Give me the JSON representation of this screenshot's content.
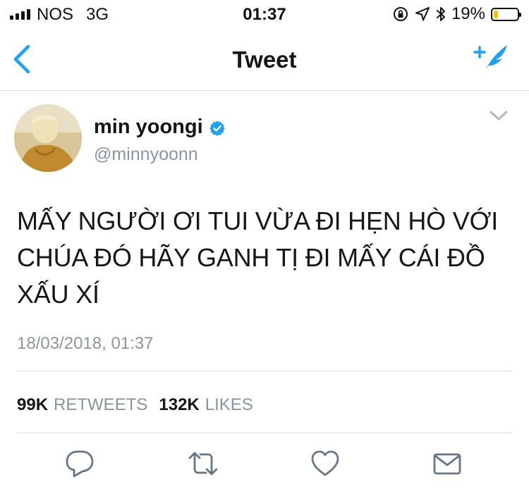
{
  "status_bar": {
    "carrier": "NOS",
    "network": "3G",
    "time": "01:37",
    "battery_percent": "19%",
    "battery_level": 0.19,
    "icons": [
      "signal-bars-icon",
      "rotation-lock-icon",
      "location-arrow-icon",
      "bluetooth-icon",
      "battery-icon"
    ]
  },
  "nav": {
    "title": "Tweet",
    "back_icon": "chevron-left-icon",
    "compose_icon": "compose-tweet-icon"
  },
  "tweet": {
    "author_name": "min yoongi",
    "handle": "@minnyoonn",
    "verified": true,
    "text": "MẤY NGƯỜI ƠI TUI VỪA ĐI HẸN HÒ VỚI CHÚA ĐÓ HÃY GANH TỊ ĐI MẤY CÁI ĐỒ XẤU XÍ",
    "timestamp": "18/03/2018, 01:37",
    "retweets_count": "99K",
    "retweets_label": "RETWEETS",
    "likes_count": "132K",
    "likes_label": "LIKES"
  },
  "actions": [
    {
      "icon": "reply-icon"
    },
    {
      "icon": "retweet-icon"
    },
    {
      "icon": "like-icon"
    },
    {
      "icon": "direct-message-icon"
    }
  ],
  "colors": {
    "accent": "#1da1f2",
    "text": "#14171a",
    "secondary_text": "#8a959e",
    "divider": "#d6dbe0",
    "battery_low": "#f5c400"
  }
}
